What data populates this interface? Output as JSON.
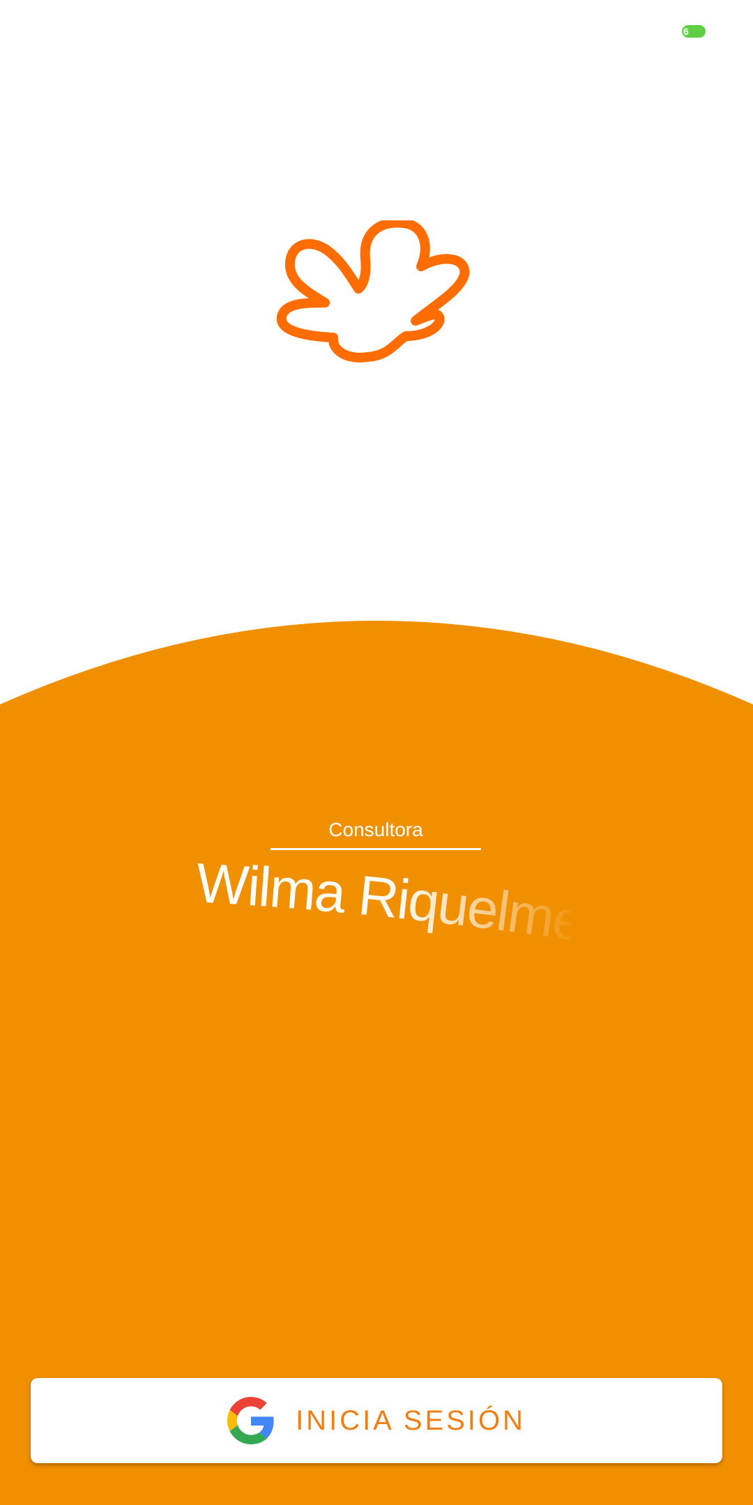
{
  "status_bar": {
    "battery_level": "6"
  },
  "branding": {
    "logo_icon": "flower-logo-icon",
    "logo_color": "#ff6d00"
  },
  "profile": {
    "role": "Consultora",
    "name": "Wilma Riquelme"
  },
  "login": {
    "button_label": "INICIA SESIÓN",
    "icon": "google-icon"
  },
  "colors": {
    "background": "#ffffff",
    "accent": "#f08f00",
    "button_text": "#ee7f12",
    "battery": "#5fcf45"
  }
}
